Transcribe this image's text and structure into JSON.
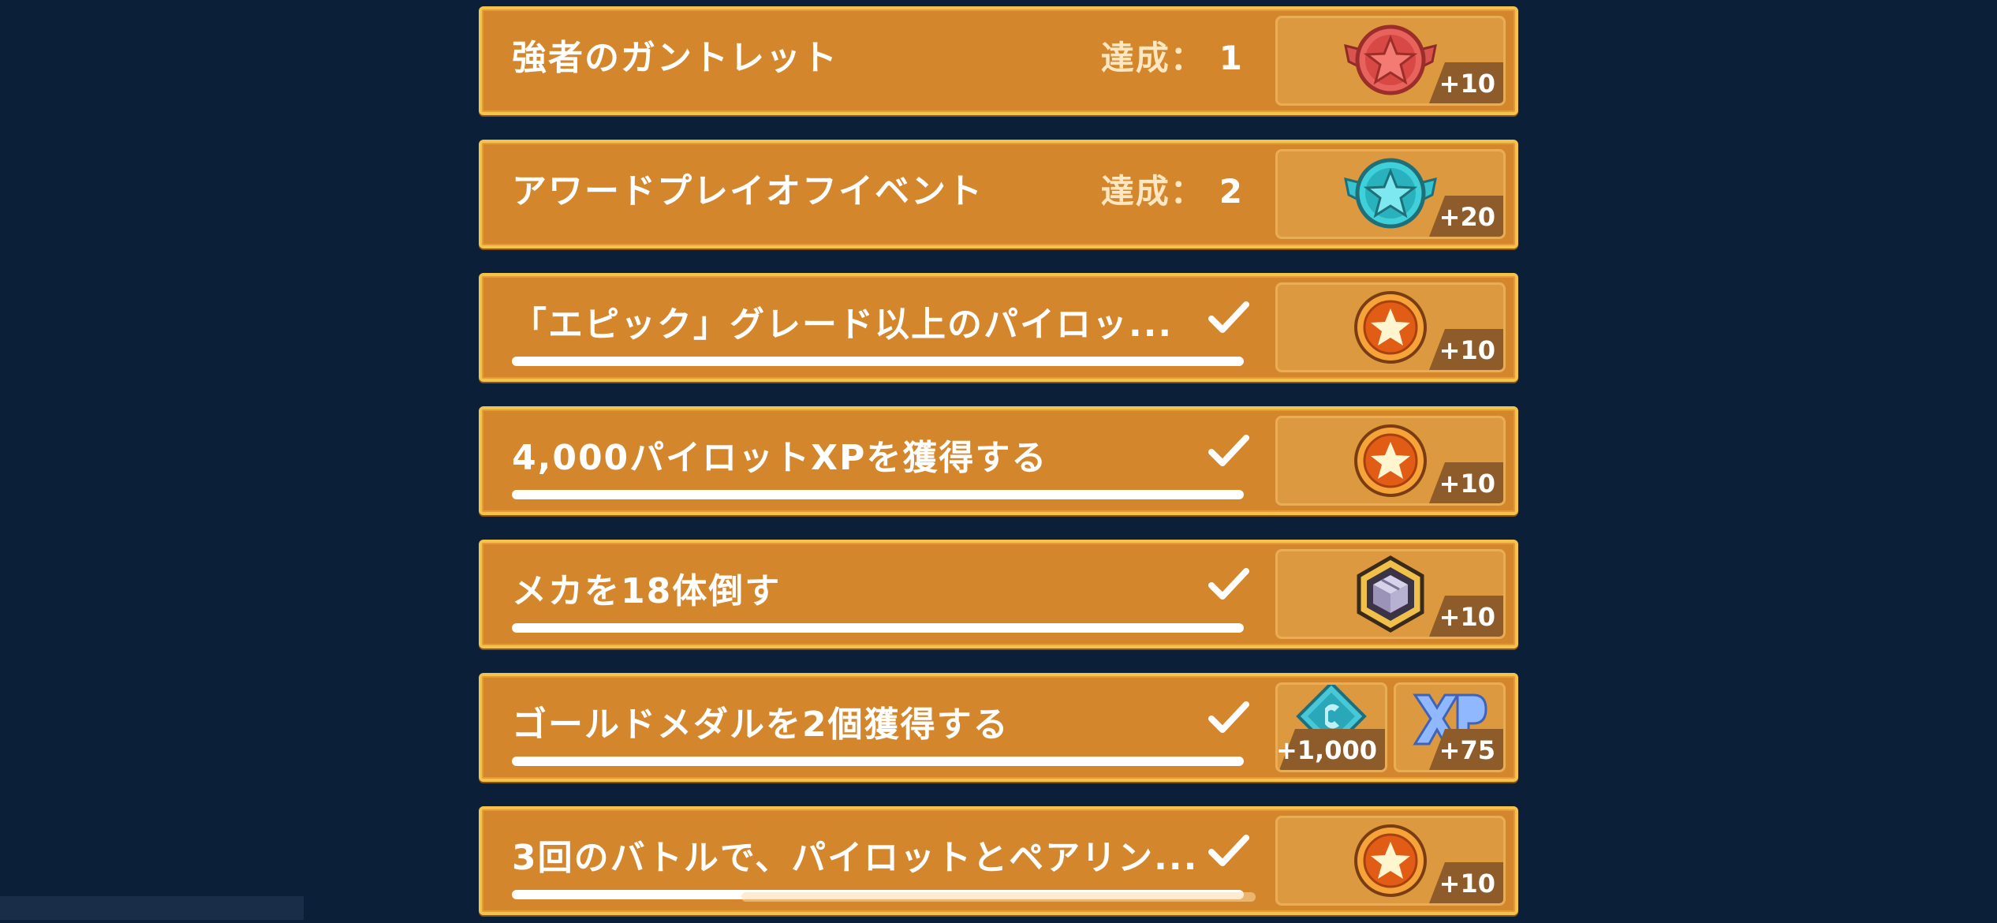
{
  "achievement_label": "達成：",
  "missions": [
    {
      "label": "強者のガントレット",
      "count": "1",
      "status": "achieved",
      "rewards": [
        {
          "icon": "red-star-badge-icon",
          "amount": "+10"
        }
      ]
    },
    {
      "label": "アワードプレイオフイベント",
      "count": "2",
      "status": "achieved",
      "rewards": [
        {
          "icon": "teal-star-badge-icon",
          "amount": "+20"
        }
      ]
    },
    {
      "label": "「エピック」グレード以上のパイロッ...",
      "status": "completed",
      "progress": 1.0,
      "rewards": [
        {
          "icon": "star-coin-icon",
          "amount": "+10"
        }
      ]
    },
    {
      "label": "4,000パイロットXPを獲得する",
      "status": "completed",
      "progress": 1.0,
      "rewards": [
        {
          "icon": "star-coin-icon",
          "amount": "+10"
        }
      ]
    },
    {
      "label": "メカを18体倒す",
      "status": "completed",
      "progress": 1.0,
      "rewards": [
        {
          "icon": "crate-badge-icon",
          "amount": "+10"
        }
      ]
    },
    {
      "label": "ゴールドメダルを2個獲得する",
      "status": "completed",
      "progress": 1.0,
      "rewards": [
        {
          "icon": "currency-gem-icon",
          "amount": "+1,000"
        },
        {
          "icon": "xp-icon",
          "amount": "+75"
        }
      ]
    },
    {
      "label": "3回のバトルで、パイロットとペアリン...",
      "status": "completed",
      "progress": 1.0,
      "rewards": [
        {
          "icon": "star-coin-icon",
          "amount": "+10"
        }
      ]
    }
  ],
  "colors": {
    "background": "#0b1f38",
    "card": "#d3862c",
    "card_border": "#f3c34a",
    "reward_box": "#dd993f"
  }
}
